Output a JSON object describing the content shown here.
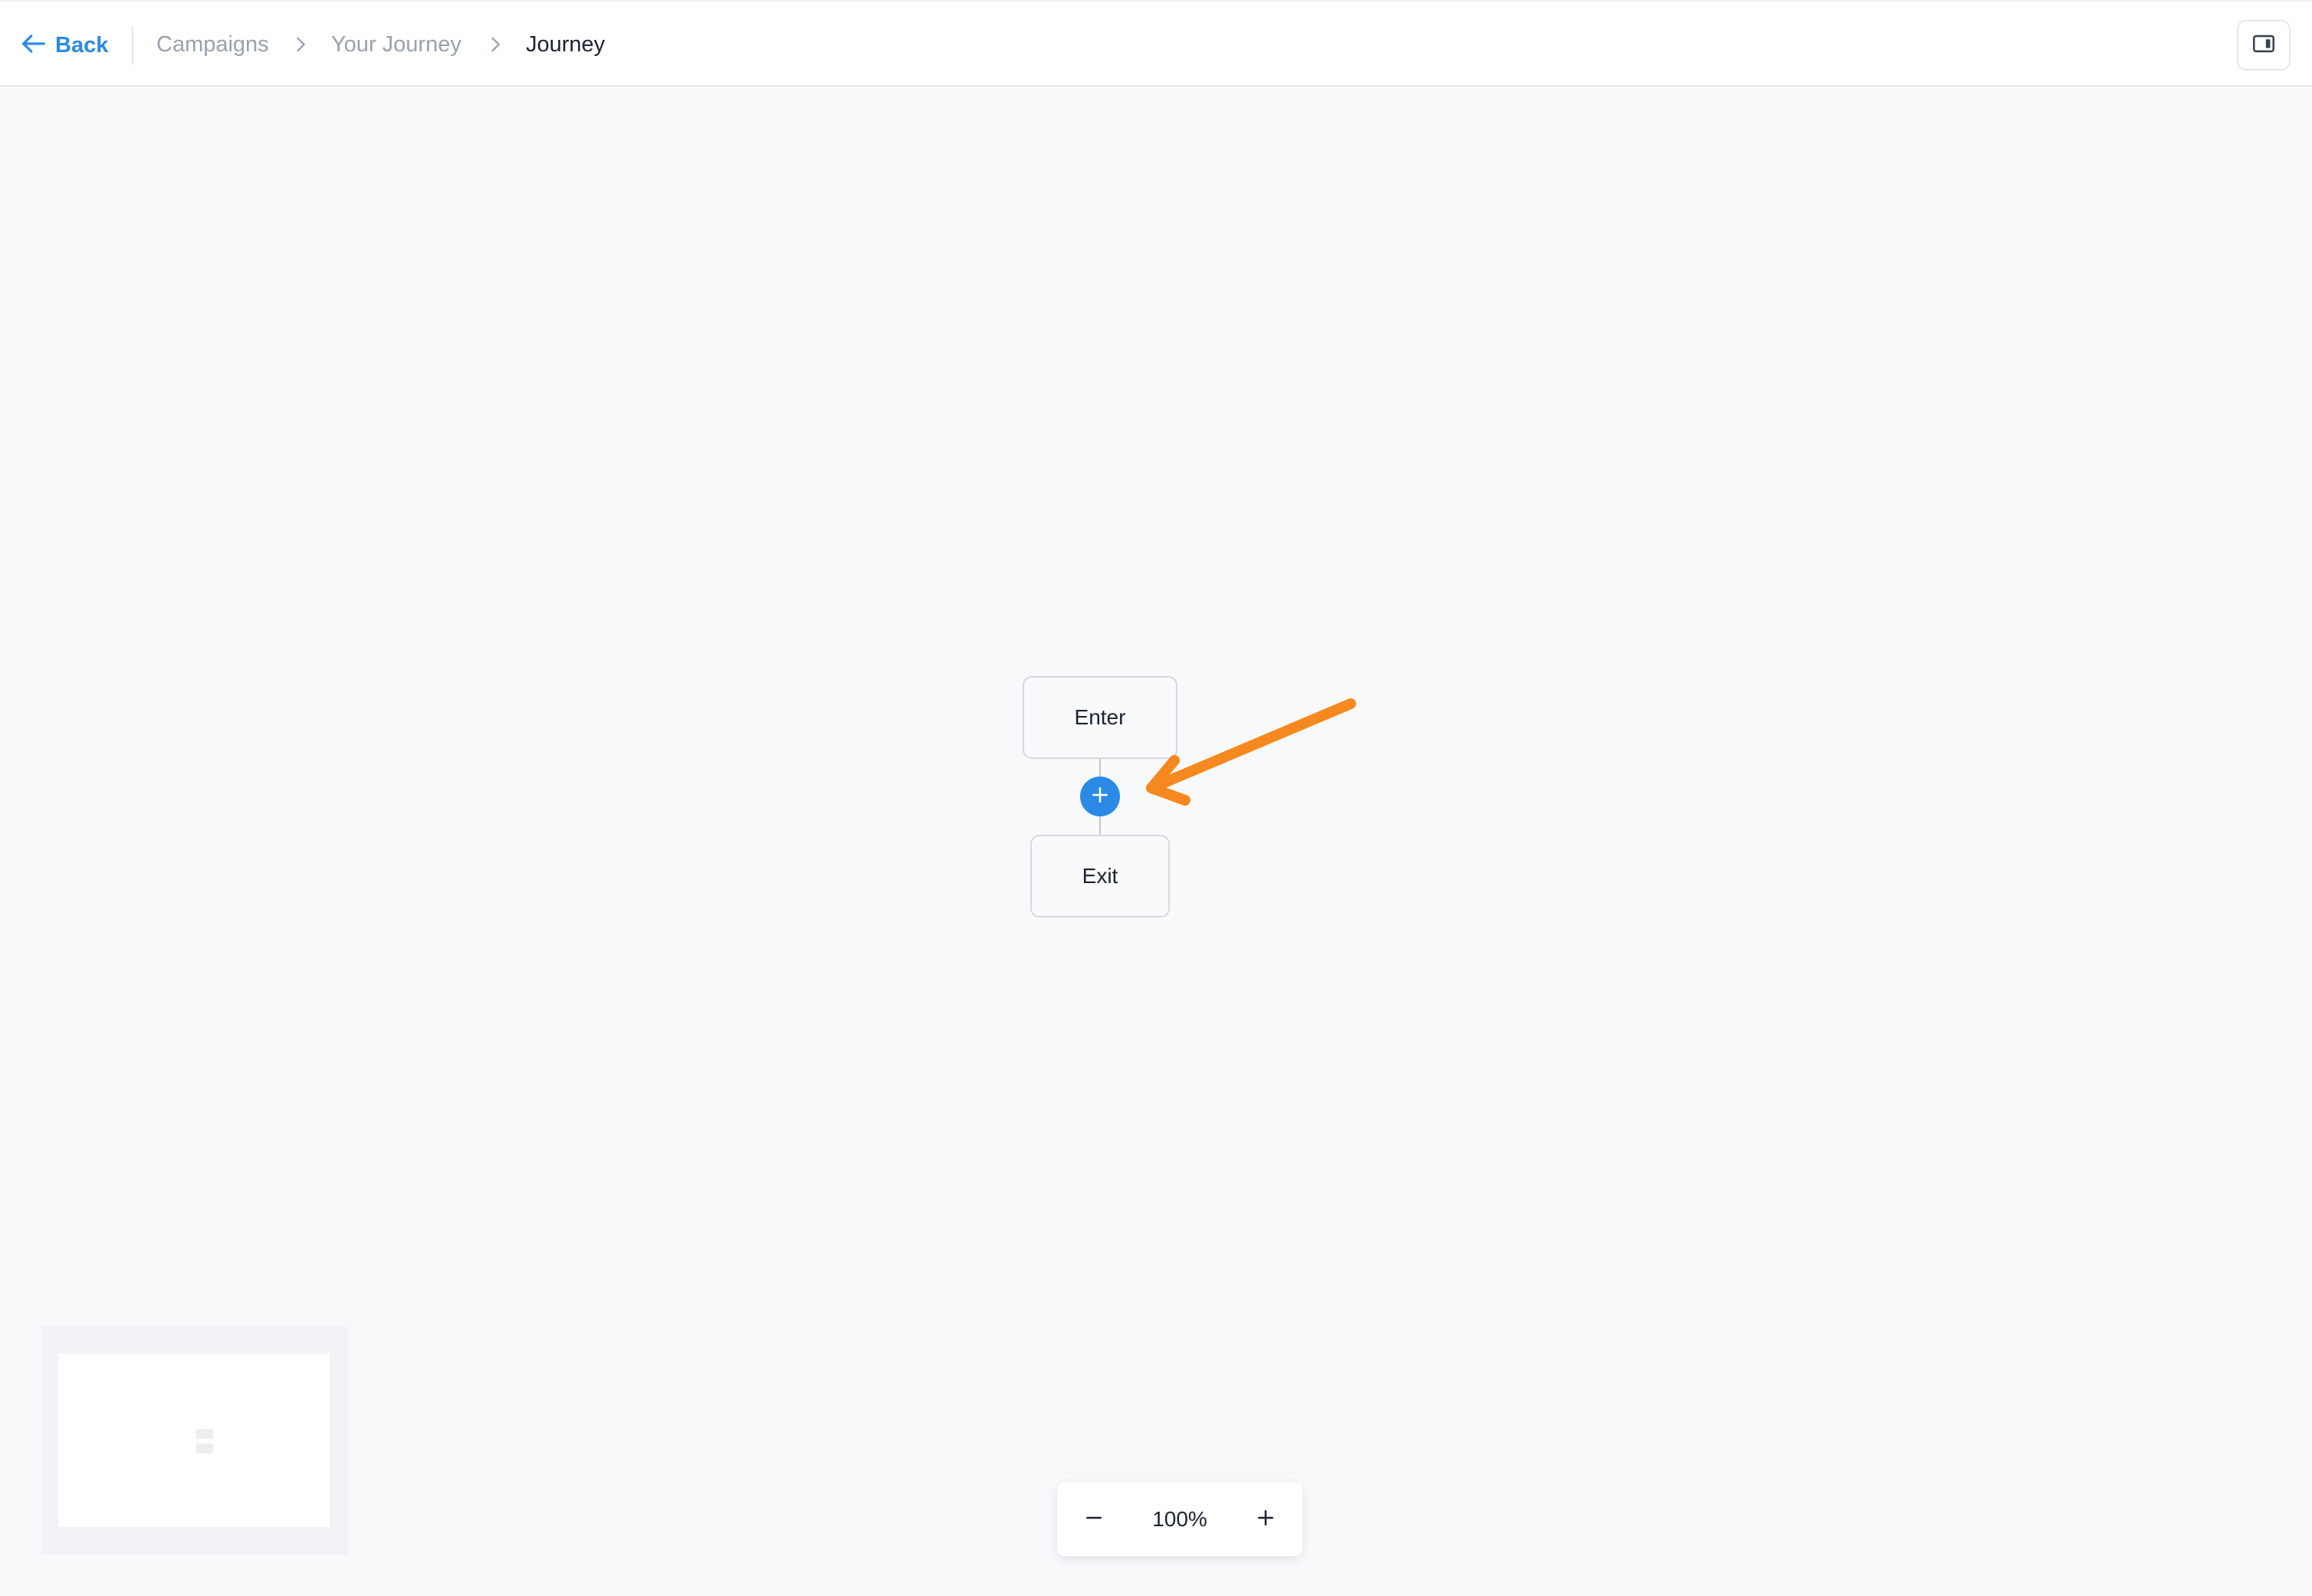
{
  "header": {
    "back_label": "Back",
    "breadcrumbs": [
      "Campaigns",
      "Your Journey",
      "Journey"
    ]
  },
  "flow": {
    "nodes": [
      {
        "label": "Enter"
      },
      {
        "label": "Exit"
      }
    ],
    "add_step_icon": "plus-icon",
    "annotation_icon": "orange-arrow-icon"
  },
  "zoom": {
    "level": "100%",
    "decrease_icon": "minus-icon",
    "increase_icon": "plus-icon"
  },
  "colors": {
    "accent": "#2b8ae6",
    "annotation": "#f5891f",
    "canvas": "#f8f9fb"
  }
}
